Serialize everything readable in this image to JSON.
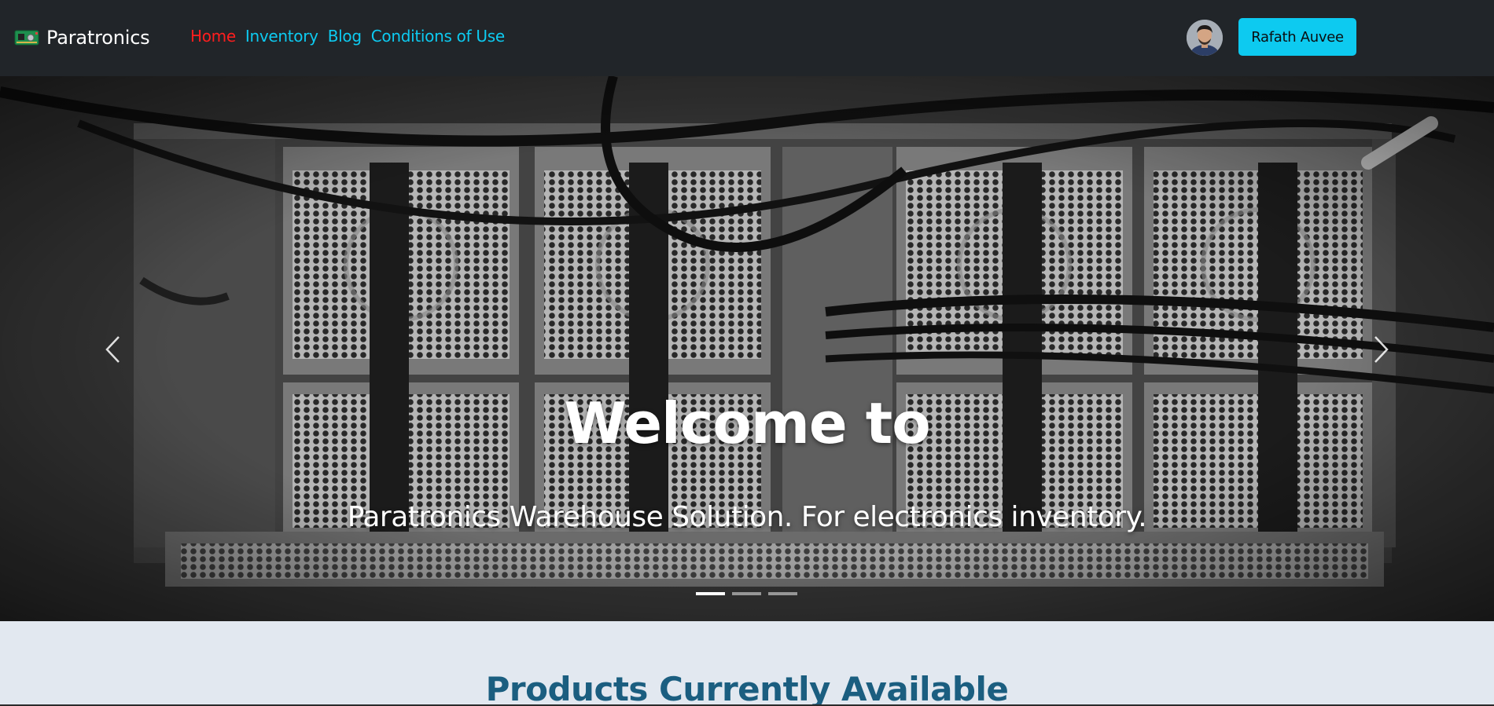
{
  "brand": {
    "name": "Paratronics",
    "logo_icon": "circuit-board-icon"
  },
  "nav": {
    "links": [
      {
        "label": "Home",
        "active": true
      },
      {
        "label": "Inventory",
        "active": false
      },
      {
        "label": "Blog",
        "active": false
      },
      {
        "label": "Conditions of Use",
        "active": false
      }
    ]
  },
  "user": {
    "name": "Rafath Auvee",
    "avatar_icon": "user-avatar"
  },
  "hero": {
    "title": "Welcome to",
    "subtitle": "Paratronics Warehouse Solution. For electronics inventory.",
    "prev_icon": "chevron-left-icon",
    "next_icon": "chevron-right-icon",
    "slide_count": 3,
    "active_slide": 1
  },
  "products": {
    "title": "Products Currently Available"
  },
  "colors": {
    "navbar_bg": "#212529",
    "link": "#0dcaf0",
    "link_active": "#ff1e1e",
    "button_bg": "#0dcaf0",
    "section_bg": "#e2e8f0",
    "section_title": "#1b5e80"
  }
}
